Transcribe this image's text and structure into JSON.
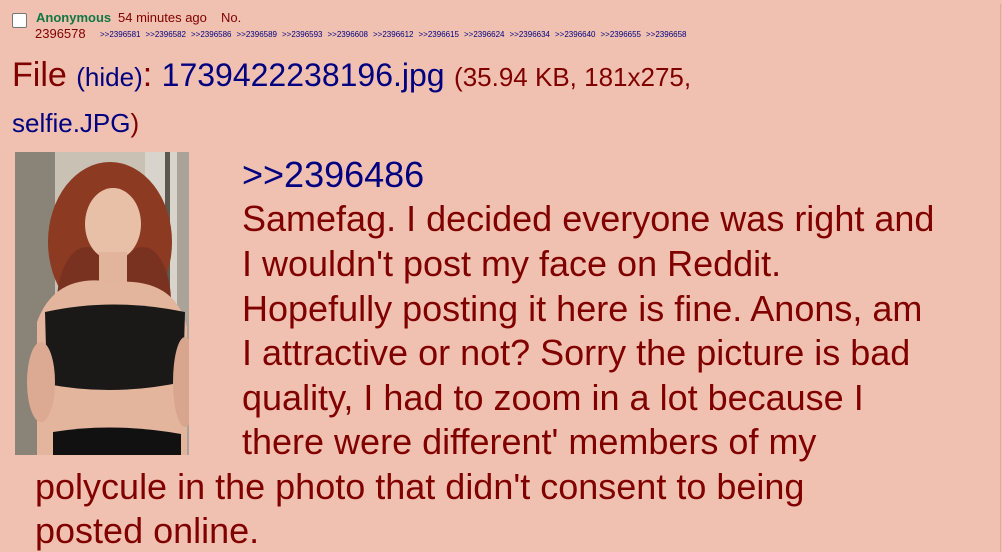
{
  "post": {
    "name": "Anonymous",
    "time": "54 minutes ago",
    "no_label": "No.",
    "post_number": "2396578",
    "backlinks": [
      ">>2396581",
      ">>2396582",
      ">>2396586",
      ">>2396589",
      ">>2396593",
      ">>2396608",
      ">>2396612",
      ">>2396615",
      ">>2396624",
      ">>2396634",
      ">>2396640",
      ">>2396655",
      ">>2396658"
    ],
    "file": {
      "label": "File",
      "hide": "(hide)",
      "colon": ":",
      "filename": "1739422238196.jpg",
      "meta": "(35.94 KB, 181x275,",
      "original_name": "selfie.JPG",
      "close_paren": ")"
    },
    "quote_link": ">>2396486",
    "message_lines": [
      "Samefag. I decided everyone was right and",
      "I wouldn't post my face on Reddit.",
      "Hopefully posting it here is fine. Anons, am",
      "I attractive or not? Sorry the picture is bad",
      "quality, I had to zoom in a lot because I",
      "there were different' members of my",
      "polycule in the photo that didn't consent to being",
      "posted online."
    ]
  },
  "colors": {
    "background": "#f0c0b0",
    "name": "#117743",
    "text": "#800000",
    "link": "#000080"
  }
}
